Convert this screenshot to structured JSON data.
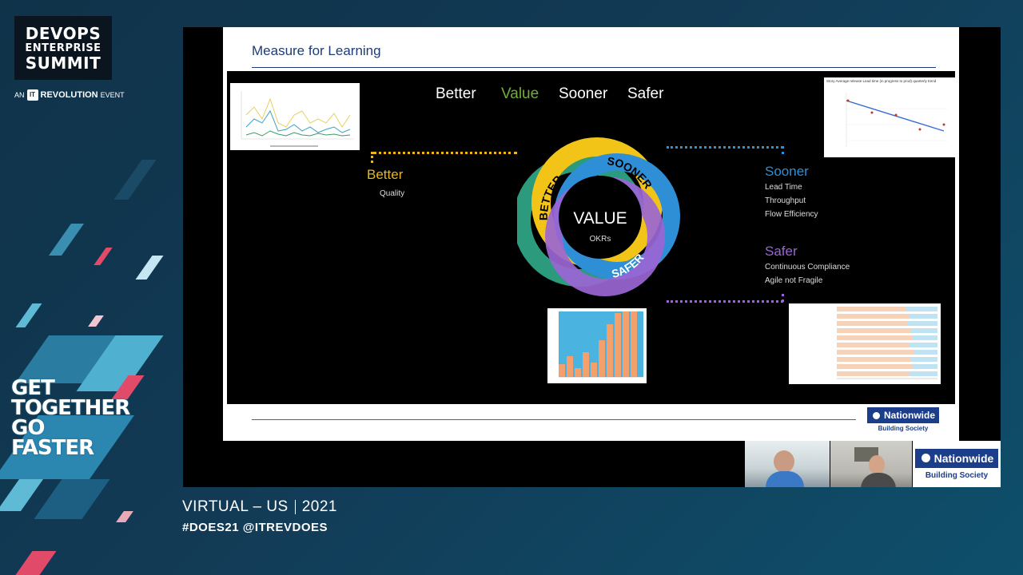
{
  "brand": {
    "line1": "DEVOPS",
    "line2": "ENTERPRISE",
    "line3": "SUMMIT",
    "an": "AN",
    "it": "IT",
    "rev": "REVOLUTION",
    "event": "EVENT"
  },
  "slogan": [
    "GET",
    "TOGETHER",
    "GO",
    "FASTER"
  ],
  "footer": {
    "virtual": "VIRTUAL – US",
    "year": "2021",
    "hashtags": "#DOES21 @ITREVDOES"
  },
  "slide": {
    "title": "Measure for Learning",
    "headline": {
      "better": "Better",
      "value": "Value",
      "sooner": "Sooner",
      "safer": "Safer"
    },
    "left": {
      "label": "Better",
      "items": [
        "Quality"
      ]
    },
    "right_top": {
      "label": "Sooner",
      "items": [
        "Lead Time",
        "Throughput",
        "Flow Efficiency"
      ]
    },
    "right_bottom": {
      "label": "Safer",
      "items": [
        "Continuous Compliance",
        "Agile not Fragile"
      ]
    },
    "wheel": {
      "center": "VALUE",
      "sub": "OKRs",
      "arc_better": "BETTER",
      "arc_sooner": "SOONER",
      "arc_safer": "SAFER"
    },
    "mini_chart_title": "Story Average release Lead time (in progress to prod) quarterly trend",
    "nationwide": {
      "name": "Nationwide",
      "tagline": "Building Society"
    }
  },
  "colors": {
    "better": "#e9b620",
    "value": "#6fae3a",
    "sooner": "#2f8fd6",
    "safer": "#8a4fc8",
    "accent_rule": "#c0392b",
    "brand_blue": "#1c3e8a"
  },
  "icons": {
    "nw_logo": "nationwide-logo-icon",
    "it_logo": "it-revolution-logo-icon"
  }
}
